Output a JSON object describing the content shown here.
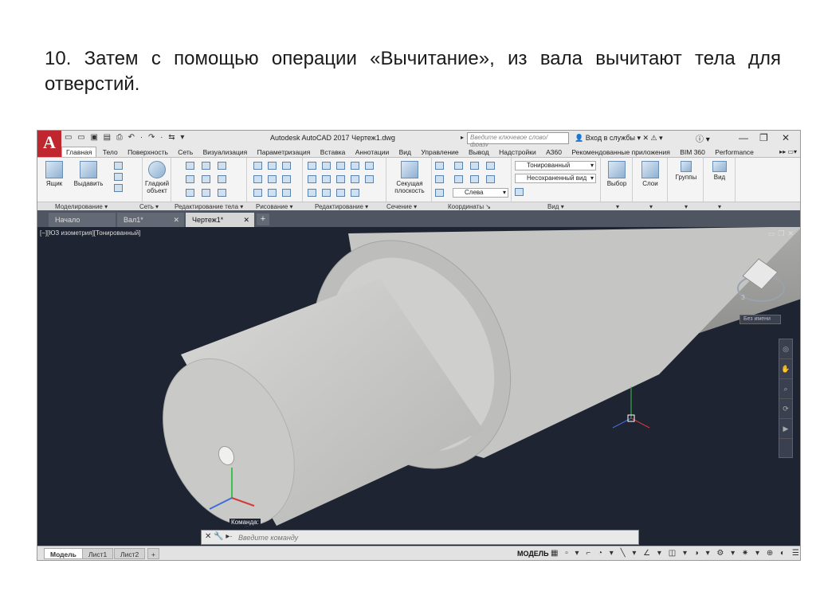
{
  "slide": {
    "text": "10. Затем с помощью операции «Вычитание», из вала вычитают тела для отверстий."
  },
  "app": {
    "logo": "A",
    "title": "Autodesk AutoCAD 2017   Чертеж1.dwg",
    "search_placeholder": "Введите ключевое слово/фразу",
    "signin_label": "Вход в службы"
  },
  "ribbon": {
    "tabs": [
      "Главная",
      "Тело",
      "Поверхность",
      "Сеть",
      "Визуализация",
      "Параметризация",
      "Вставка",
      "Аннотации",
      "Вид",
      "Управление",
      "Вывод",
      "Надстройки",
      "A360",
      "Рекомендованные приложения",
      "BIM 360",
      "Performance"
    ],
    "buttons": {
      "box": "Ящик",
      "extrude": "Выдавить",
      "smooth_object": "Гладкий объект",
      "section_plane": "Секущая плоскость",
      "selection": "Выбор",
      "layers": "Слои",
      "groups": "Группы",
      "view": "Вид"
    },
    "combos": {
      "visual_style": "Тонированный",
      "named_view": "Несохраненный вид",
      "ucs_view": "Слева"
    },
    "group_labels": [
      "Моделирование",
      "Сеть",
      "Редактирование тела",
      "Рисование",
      "Редактирование",
      "Сечение",
      "Координаты",
      "Вид"
    ]
  },
  "doc_tabs": [
    "Начало",
    "Вал1*",
    "Чертеж1*"
  ],
  "viewport": {
    "label": "[−][ЮЗ изометрия][Тонированный]",
    "ucs_name": "Без имени",
    "navcube": {
      "face_letter": "З"
    }
  },
  "command": {
    "label": "Команда:",
    "placeholder": "Введите команду"
  },
  "status": {
    "layout_tabs": [
      "Модель",
      "Лист1",
      "Лист2"
    ],
    "model_label": "МОДЕЛЬ"
  },
  "colors": {
    "viewport_bg": "#1f2432",
    "logo_red": "#c0262d",
    "shaft": "#c8c8c6"
  }
}
